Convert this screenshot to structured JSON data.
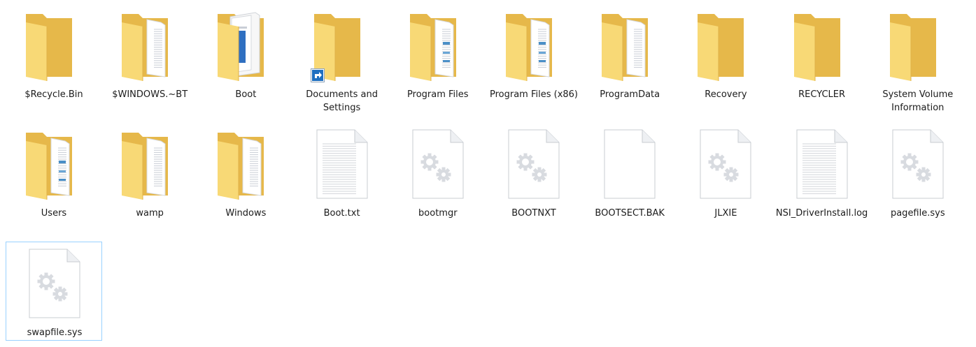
{
  "items": [
    {
      "name": "$Recycle.Bin",
      "type": "folder-plain"
    },
    {
      "name": "$WINDOWS.~BT",
      "type": "folder-docs"
    },
    {
      "name": "Boot",
      "type": "folder-boot"
    },
    {
      "name": "Documents and Settings",
      "type": "folder-shortcut"
    },
    {
      "name": "Program Files",
      "type": "folder-blue"
    },
    {
      "name": "Program Files (x86)",
      "type": "folder-blue"
    },
    {
      "name": "ProgramData",
      "type": "folder-docs"
    },
    {
      "name": "Recovery",
      "type": "folder-plain"
    },
    {
      "name": "RECYCLER",
      "type": "folder-plain"
    },
    {
      "name": "System Volume Information",
      "type": "folder-plain"
    },
    {
      "name": "Users",
      "type": "folder-blue"
    },
    {
      "name": "wamp",
      "type": "folder-docs"
    },
    {
      "name": "Windows",
      "type": "folder-docs"
    },
    {
      "name": "Boot.txt",
      "type": "file-text"
    },
    {
      "name": "bootmgr",
      "type": "file-system"
    },
    {
      "name": "BOOTNXT",
      "type": "file-system"
    },
    {
      "name": "BOOTSECT.BAK",
      "type": "file-blank"
    },
    {
      "name": "JLXIE",
      "type": "file-system"
    },
    {
      "name": "NSI_DriverInstall.log",
      "type": "file-text"
    },
    {
      "name": "pagefile.sys",
      "type": "file-system"
    },
    {
      "name": "swapfile.sys",
      "type": "file-system",
      "selected": true
    }
  ],
  "colors": {
    "folder_back": "#e6b84a",
    "folder_front": "#f8d976",
    "selection_border": "#99d1ff",
    "label_text": "#1b1b1b"
  }
}
